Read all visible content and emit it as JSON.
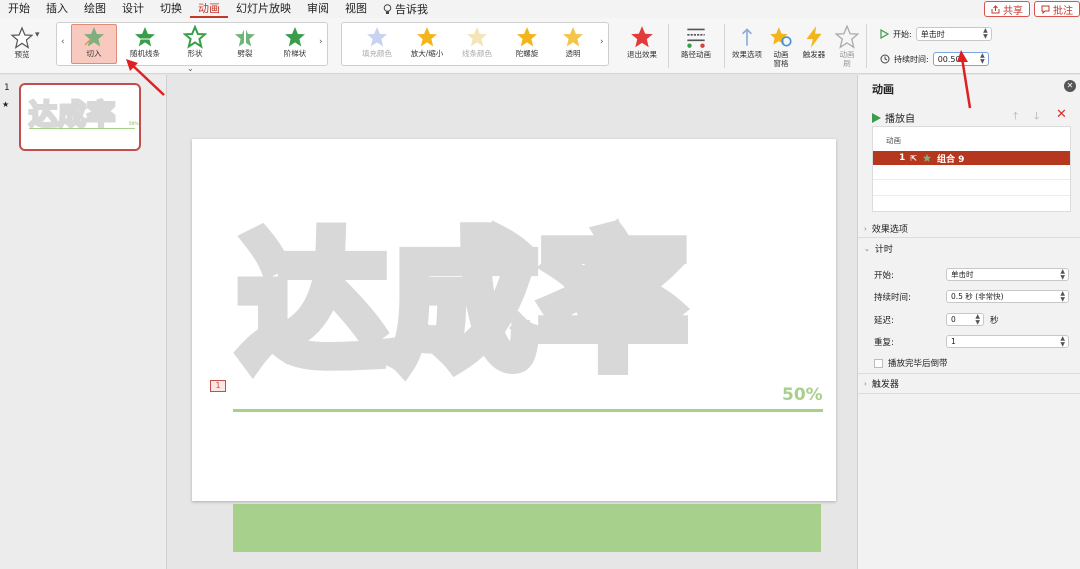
{
  "menu": {
    "tabs": [
      "开始",
      "插入",
      "绘图",
      "设计",
      "切换",
      "动画",
      "幻灯片放映",
      "审阅",
      "视图"
    ],
    "active_tab": "动画",
    "tell_me": "告诉我",
    "share": "共享",
    "comment": "批注"
  },
  "ribbon": {
    "preview": "预览",
    "entrance_effects": [
      "切入",
      "随机线条",
      "形状",
      "劈裂",
      "阶梯状"
    ],
    "selected_effect": "切入",
    "emphasis_effects": [
      "填充颜色",
      "放大/缩小",
      "线条颜色",
      "陀螺旋",
      "透明"
    ],
    "exit_effects": "退出效果",
    "motion_paths": "路径动画",
    "effect_options": "效果选项",
    "animation_pane": "动画\n窗格",
    "trigger": "触发器",
    "animation_painter": "动画\n刷",
    "timing": {
      "start_label": "开始:",
      "start_value": "单击时",
      "duration_label": "持续时间:",
      "duration_value": "00.50"
    },
    "colors": {
      "accent": "#c0392b",
      "star_green": "#3a9d4a",
      "star_gold": "#f2b61c",
      "star_red": "#e23b3b"
    }
  },
  "thumbnails": [
    {
      "number": "1",
      "star": "★",
      "text": "达成率",
      "pct": "50%"
    }
  ],
  "slide": {
    "main_text": "达成率",
    "percent": "50%",
    "anim_tag": "1",
    "colors": {
      "text": "#d8d8d8",
      "green": "#a8d08d"
    }
  },
  "pane": {
    "title": "动画",
    "play_from": "播放自",
    "list_header": "动画",
    "items": [
      {
        "index": "1",
        "name": "组合 9"
      }
    ],
    "effect_options": "效果选项",
    "timing_section": "计时",
    "start_label": "开始:",
    "start_value": "单击时",
    "duration_label": "持续时间:",
    "duration_value": "0.5 秒 (非常快)",
    "delay_label": "延迟:",
    "delay_value": "0",
    "delay_unit": "秒",
    "repeat_label": "重复:",
    "repeat_value": "1",
    "rewind_label": "播放完毕后倒带",
    "trigger_section": "触发器"
  }
}
